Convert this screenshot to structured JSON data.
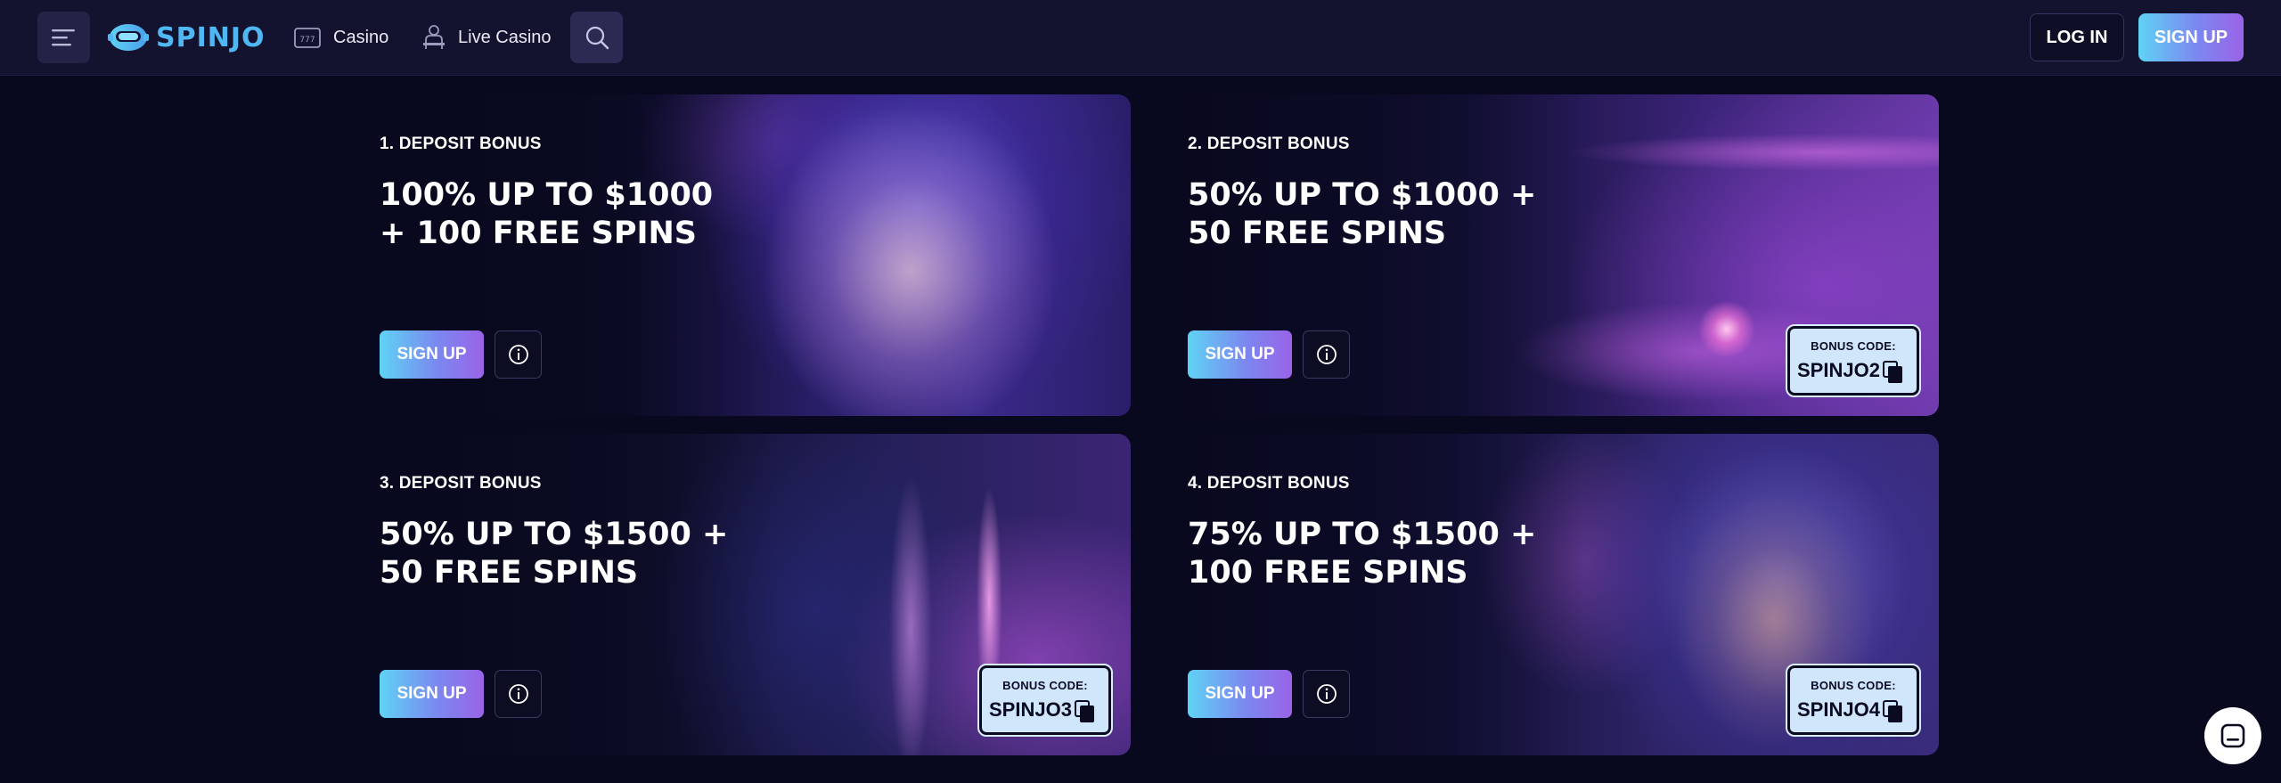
{
  "header": {
    "brand": "SPINJO",
    "nav": [
      {
        "label": "Casino",
        "icon": "slot-machine-icon"
      },
      {
        "label": "Live Casino",
        "icon": "dealer-icon"
      }
    ],
    "login_label": "LOG IN",
    "signup_label": "SIGN UP"
  },
  "cards": [
    {
      "label": "1. DEPOSIT BONUS",
      "title_line1": "100% UP TO $1000",
      "title_line2": "+ 100 FREE SPINS",
      "signup_label": "SIGN UP"
    },
    {
      "label": "2. DEPOSIT BONUS",
      "title_line1": "50% UP TO $1000 +",
      "title_line2": "50 FREE SPINS",
      "signup_label": "SIGN UP",
      "bonus_code_label": "BONUS CODE:",
      "bonus_code": "SPINJO2"
    },
    {
      "label": "3. DEPOSIT BONUS",
      "title_line1": "50% UP TO $1500 +",
      "title_line2": "50 FREE SPINS",
      "signup_label": "SIGN UP",
      "bonus_code_label": "BONUS CODE:",
      "bonus_code": "SPINJO3"
    },
    {
      "label": "4. DEPOSIT BONUS",
      "title_line1": "75% UP TO $1500 +",
      "title_line2": "100 FREE SPINS",
      "signup_label": "SIGN UP",
      "bonus_code_label": "BONUS CODE:",
      "bonus_code": "SPINJO4"
    }
  ],
  "colors": {
    "background": "#08081e",
    "header": "#13132f",
    "accent_start": "#5fd3f5",
    "accent_end": "#9a63e8",
    "bonus_code_bg": "#cfe6fb"
  }
}
